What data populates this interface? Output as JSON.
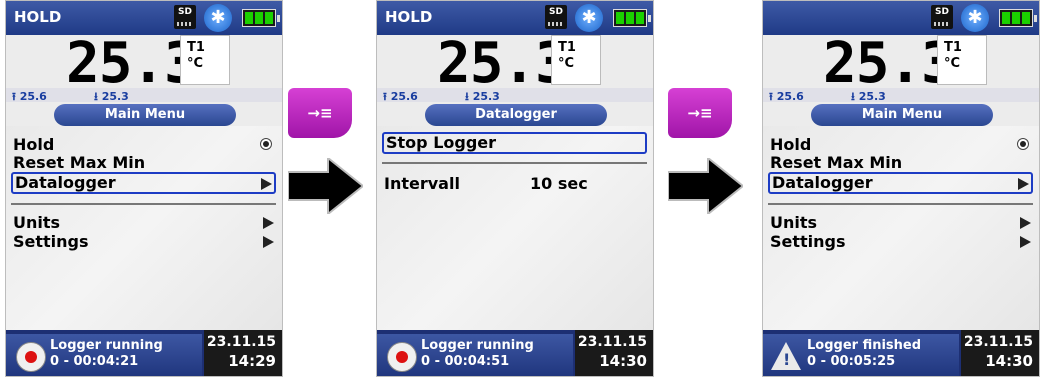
{
  "screens": [
    {
      "hold_label": "HOLD",
      "sd_label": "SD",
      "bt_icon": "bluetooth-icon",
      "value": "25.3",
      "channel": "T1",
      "unit": "°C",
      "max_value": "25.6",
      "min_value": "25.3",
      "menu_title": "Main Menu",
      "items": [
        "Hold",
        "Reset Max Min",
        "Datalogger",
        "Units",
        "Settings"
      ],
      "status_line1": "Logger running",
      "status_line2": "0 - 00:04:21",
      "date": "23.11.15",
      "time": "14:29"
    },
    {
      "hold_label": "HOLD",
      "sd_label": "SD",
      "bt_icon": "bluetooth-icon",
      "value": "25.3",
      "channel": "T1",
      "unit": "°C",
      "max_value": "25.6",
      "min_value": "25.3",
      "menu_title": "Datalogger",
      "stop_item": "Stop Logger",
      "interval_label": "Intervall",
      "interval_value": "10 sec",
      "status_line1": "Logger running",
      "status_line2": "0 - 00:04:51",
      "date": "23.11.15",
      "time": "14:30"
    },
    {
      "hold_label": "",
      "sd_label": "SD",
      "bt_icon": "bluetooth-icon",
      "value": "25.3",
      "channel": "T1",
      "unit": "°C",
      "max_value": "25.6",
      "min_value": "25.3",
      "menu_title": "Main Menu",
      "items": [
        "Hold",
        "Reset Max Min",
        "Datalogger",
        "Units",
        "Settings"
      ],
      "status_line1": "Logger finished",
      "status_line2": "0 - 00:05:25",
      "date": "23.11.15",
      "time": "14:30"
    }
  ],
  "function_key": {
    "icon": "logger-key-icon",
    "label": "→≡"
  },
  "colors": {
    "accent": "#2a4791",
    "selection": "#1d3cc4",
    "function_key": "#c02bc2"
  }
}
